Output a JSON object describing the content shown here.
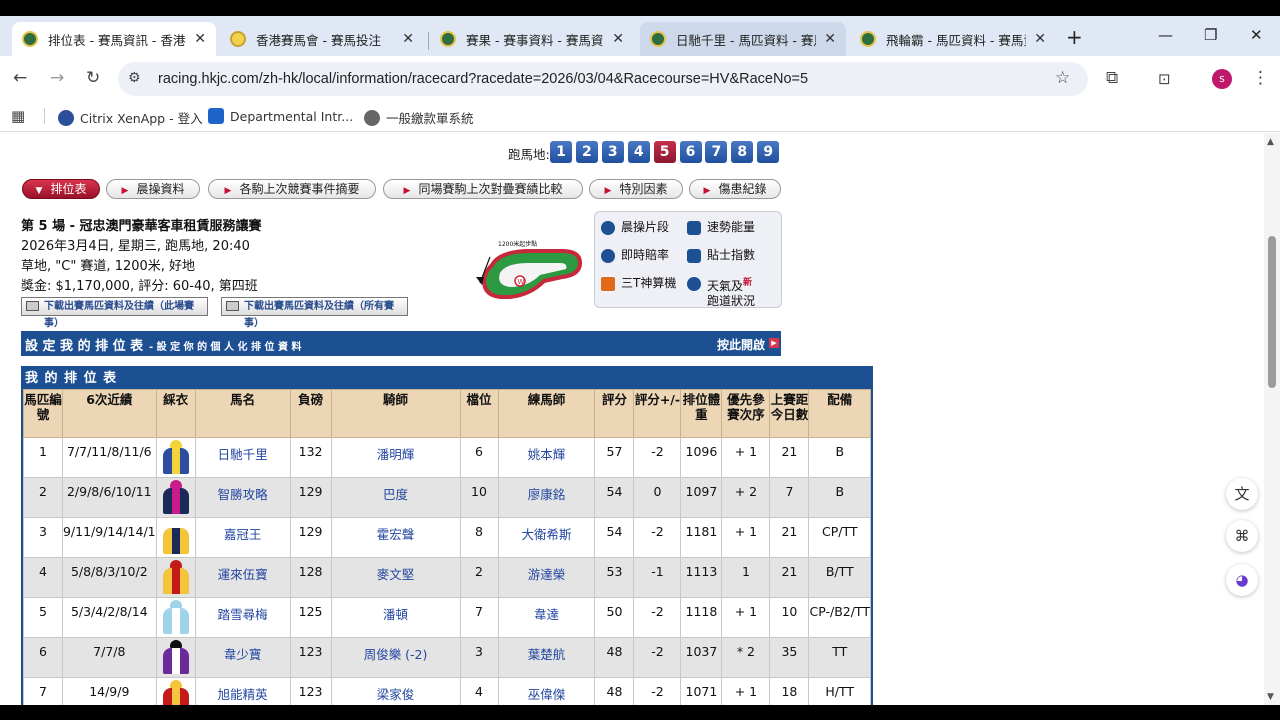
{
  "tabs": [
    {
      "title": "排位表 - 賽馬資訊 - 香港賽",
      "active": true
    },
    {
      "title": "香港賽馬會 - 賽馬投注"
    },
    {
      "title": "賽果 - 賽事資料 - 賽馬資訊"
    },
    {
      "title": "日馳千里 - 馬匹資料 - 賽馬"
    },
    {
      "title": "飛輪霸 - 馬匹資料 - 賽馬資"
    }
  ],
  "url": "racing.hkjc.com/zh-hk/local/information/racecard?racedate=2026/03/04&Racecourse=HV&RaceNo=5",
  "bookmarks": [
    "Citrix XenApp - 登入",
    "Departmental Intr...",
    "一般繳款單系統"
  ],
  "race_nav": {
    "label": "跑馬地:",
    "races": [
      "1",
      "2",
      "3",
      "4",
      "5",
      "6",
      "7",
      "8",
      "9"
    ],
    "selected": "5"
  },
  "subtabs": [
    "排位表",
    "晨操資料",
    "各駒上次競賽事件摘要",
    "同場賽駒上次對疊賽績比較",
    "特別因素",
    "傷患紀錄"
  ],
  "race_info": {
    "title": "第 5 場 - 冠忠澳門豪華客車租賃服務讓賽",
    "line1": "2026年3月4日, 星期三, 跑馬地, 20:40",
    "line2": "草地, \"C\" 賽道, 1200米, 好地",
    "line3": "獎金: $1,170,000, 評分: 60-40, 第四班"
  },
  "track_map_label": "1200米起步點",
  "download": [
    "下載出賽馬匹資料及往績（此場賽事）",
    "下載出賽馬匹資料及往績（所有賽事）"
  ],
  "tools": {
    "morning": "晨操片段",
    "speed": "速勢能量",
    "odds": "即時賠率",
    "tips": "貼士指數",
    "tt": "三T神算機",
    "weather": "天氣及",
    "weather2": "跑道狀況",
    "new": "新"
  },
  "customize": {
    "title": "設 定 我 的 排 位 表",
    "sub": "- 設 定 你 的 個 人 化 排 位 資 料",
    "open": "按此開啟"
  },
  "my_table": {
    "caption": "我 的 排 位 表",
    "headers": [
      "馬匹編號",
      "6次近績",
      "綵衣",
      "馬名",
      "負磅",
      "騎師",
      "檔位",
      "練馬師",
      "評分",
      "評分+/-",
      "排位體重",
      "優先參賽次序",
      "上賽距今日數",
      "配備"
    ],
    "rows": [
      {
        "no": "1",
        "form": "7/7/11/8/11/6",
        "horse": "日馳千里",
        "wt": "132",
        "jockey": "潘明輝",
        "draw": "6",
        "trainer": "姚本輝",
        "rating": "57",
        "diff": "-2",
        "bw": "1096",
        "pri": "+ 1",
        "days": "21",
        "gear": "B"
      },
      {
        "no": "2",
        "form": "2/9/8/6/10/11",
        "horse": "智勝攻略",
        "wt": "129",
        "jockey": "巴度",
        "draw": "10",
        "trainer": "廖康銘",
        "rating": "54",
        "diff": "0",
        "bw": "1097",
        "pri": "+ 2",
        "days": "7",
        "gear": "B"
      },
      {
        "no": "3",
        "form": "9/11/9/14/14/1",
        "horse": "嘉冠王",
        "wt": "129",
        "jockey": "霍宏聲",
        "draw": "8",
        "trainer": "大衛希斯",
        "rating": "54",
        "diff": "-2",
        "bw": "1181",
        "pri": "+ 1",
        "days": "21",
        "gear": "CP/TT"
      },
      {
        "no": "4",
        "form": "5/8/8/3/10/2",
        "horse": "運來伍寶",
        "wt": "128",
        "jockey": "麥文堅",
        "draw": "2",
        "trainer": "游達榮",
        "rating": "53",
        "diff": "-1",
        "bw": "1113",
        "pri": "1",
        "days": "21",
        "gear": "B/TT"
      },
      {
        "no": "5",
        "form": "5/3/4/2/8/14",
        "horse": "踏雪尋梅",
        "wt": "125",
        "jockey": "潘頓",
        "draw": "7",
        "trainer": "韋達",
        "rating": "50",
        "diff": "-2",
        "bw": "1118",
        "pri": "+ 1",
        "days": "10",
        "gear": "CP-/B2/TT"
      },
      {
        "no": "6",
        "form": "7/7/8",
        "horse": "韋少寶",
        "wt": "123",
        "jockey": "周俊樂 (-2)",
        "draw": "3",
        "trainer": "葉楚航",
        "rating": "48",
        "diff": "-2",
        "bw": "1037",
        "pri": "* 2",
        "days": "35",
        "gear": "TT"
      },
      {
        "no": "7",
        "form": "14/9/9",
        "horse": "旭能精英",
        "wt": "123",
        "jockey": "梁家俊",
        "draw": "4",
        "trainer": "巫偉傑",
        "rating": "48",
        "diff": "-2",
        "bw": "1071",
        "pri": "+ 1",
        "days": "18",
        "gear": "H/TT"
      }
    ]
  },
  "silks": [
    {
      "cap": "#f2d33a",
      "body": "#2d4e9e",
      "accent": "#f2d33a"
    },
    {
      "cap": "#c81c8c",
      "body": "#1c2a5a",
      "accent": "#c81c8c"
    },
    {
      "cap": "#ffffff",
      "body": "#f3c53a",
      "accent": "#1c2a5a"
    },
    {
      "cap": "#c41a1a",
      "body": "#f3c53a",
      "accent": "#c41a1a"
    },
    {
      "cap": "#9fd4e8",
      "body": "#9fd4e8",
      "accent": "#ffffff"
    },
    {
      "cap": "#111111",
      "body": "#6a2a9a",
      "accent": "#ffffff"
    },
    {
      "cap": "#f3c53a",
      "body": "#c41a1a",
      "accent": "#f3c53a"
    }
  ]
}
